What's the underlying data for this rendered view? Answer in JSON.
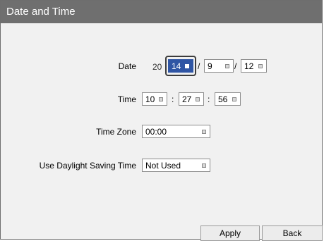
{
  "window": {
    "title": "Date and Time"
  },
  "date": {
    "label": "Date",
    "century": "20",
    "year": "14",
    "separator": "/",
    "month": "9",
    "day": "12"
  },
  "time": {
    "label": "Time",
    "separator": ":",
    "hour": "10",
    "minute": "27",
    "second": "56"
  },
  "timezone": {
    "label": "Time Zone",
    "value": "00:00"
  },
  "dst": {
    "label": "Use Daylight Saving Time",
    "value": "Not Used"
  },
  "buttons": {
    "apply": "Apply",
    "back": "Back"
  },
  "colors": {
    "titlebar": "#6f6f6f",
    "selected": "#2f55a4",
    "panel": "#f1f1f1"
  },
  "icons": {
    "spin": "spin-indicator-icon"
  }
}
